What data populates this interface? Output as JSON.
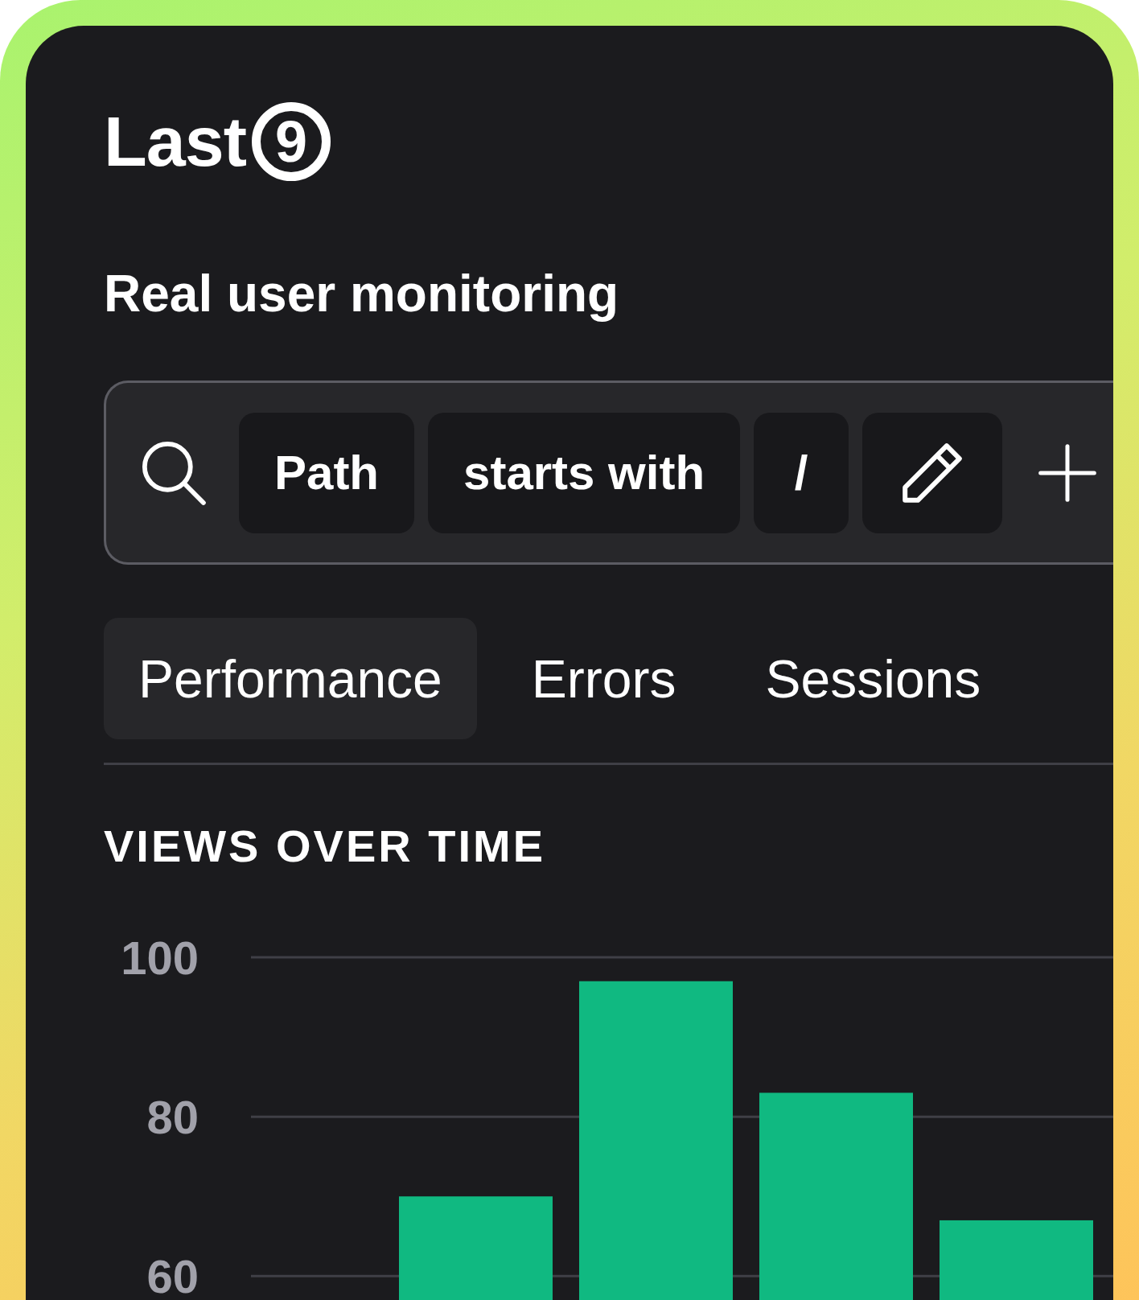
{
  "logo": {
    "wordmark": "Last",
    "badge": "9"
  },
  "title": "Real user monitoring",
  "filter_bar": {
    "chips": [
      "Path",
      "starts with",
      "/"
    ]
  },
  "tabs": [
    {
      "label": "Performance",
      "selected": true
    },
    {
      "label": "Errors",
      "selected": false
    },
    {
      "label": "Sessions",
      "selected": false
    }
  ],
  "views_chart": {
    "chart_data": {
      "type": "bar",
      "title": "VIEWS OVER TIME",
      "ylim": [
        57,
        100
      ],
      "yticks": [
        60,
        80,
        100
      ],
      "values": [
        null,
        70,
        97,
        83,
        67
      ]
    }
  }
}
